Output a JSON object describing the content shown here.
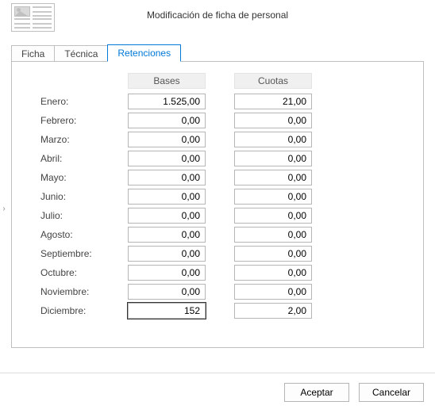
{
  "title": "Modificación de ficha de personal",
  "tabs": {
    "ficha": "Ficha",
    "tecnica": "Técnica",
    "retenciones": "Retenciones"
  },
  "columns": {
    "bases": "Bases",
    "cuotas": "Cuotas"
  },
  "rows": [
    {
      "label": "Enero:",
      "bases": "1.525,00",
      "cuotas": "21,00"
    },
    {
      "label": "Febrero:",
      "bases": "0,00",
      "cuotas": "0,00"
    },
    {
      "label": "Marzo:",
      "bases": "0,00",
      "cuotas": "0,00"
    },
    {
      "label": "Abril:",
      "bases": "0,00",
      "cuotas": "0,00"
    },
    {
      "label": "Mayo:",
      "bases": "0,00",
      "cuotas": "0,00"
    },
    {
      "label": "Junio:",
      "bases": "0,00",
      "cuotas": "0,00"
    },
    {
      "label": "Julio:",
      "bases": "0,00",
      "cuotas": "0,00"
    },
    {
      "label": "Agosto:",
      "bases": "0,00",
      "cuotas": "0,00"
    },
    {
      "label": "Septiembre:",
      "bases": "0,00",
      "cuotas": "0,00"
    },
    {
      "label": "Octubre:",
      "bases": "0,00",
      "cuotas": "0,00"
    },
    {
      "label": "Noviembre:",
      "bases": "0,00",
      "cuotas": "0,00"
    },
    {
      "label": "Diciembre:",
      "bases": "152",
      "cuotas": "2,00"
    }
  ],
  "active_edit_index": 11,
  "buttons": {
    "accept": "Aceptar",
    "cancel": "Cancelar"
  },
  "side_handle_glyph": "›"
}
